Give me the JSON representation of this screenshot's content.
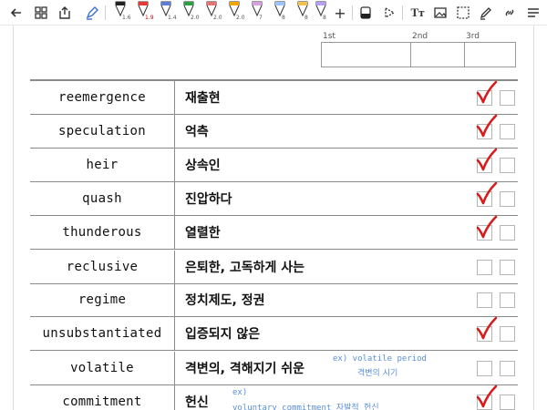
{
  "toolbar": {
    "back_icon": "arrow-left-icon",
    "pen_sizes": [
      "1.6",
      "1.9",
      "1.4",
      "2.0",
      "2.0",
      "2.0",
      "7",
      "8",
      "8",
      "8"
    ],
    "pen_colors": [
      "#222222",
      "#e53935",
      "#5b7fd6",
      "#2e9e44",
      "#e57373",
      "#f0a500",
      "#d7a0e0",
      "#9cc3ff",
      "#f2c14e",
      "#b59cf5"
    ],
    "add_label": "+",
    "text_label": "Tт"
  },
  "header": {
    "attempts": [
      "1st",
      "2nd",
      "3rd"
    ]
  },
  "words": [
    {
      "english": "reemergence",
      "korean": "재출현",
      "checked": true
    },
    {
      "english": "speculation",
      "korean": "억측",
      "checked": true
    },
    {
      "english": "heir",
      "korean": "상속인",
      "checked": true
    },
    {
      "english": "quash",
      "korean": "진압하다",
      "checked": true
    },
    {
      "english": "thunderous",
      "korean": "열렬한",
      "checked": true
    },
    {
      "english": "reclusive",
      "korean": "은퇴한, 고독하게 사는",
      "checked": false
    },
    {
      "english": "regime",
      "korean": "정치제도, 정권",
      "checked": false
    },
    {
      "english": "unsubstantiated",
      "korean": "입증되지 않은",
      "checked": true
    },
    {
      "english": "volatile",
      "korean": "격변의, 격해지기 쉬운",
      "checked": false
    },
    {
      "english": "commitment",
      "korean": "헌신",
      "checked": true
    }
  ],
  "notes": {
    "volatile_line1": "ex) volatile period",
    "volatile_line2": "격변의 시기",
    "commitment_line1": "ex)",
    "commitment_line2": "voluntary commitment 자발적 헌신"
  },
  "colors": {
    "check_red": "#d81b1b",
    "note_blue": "#5a8fd8"
  }
}
